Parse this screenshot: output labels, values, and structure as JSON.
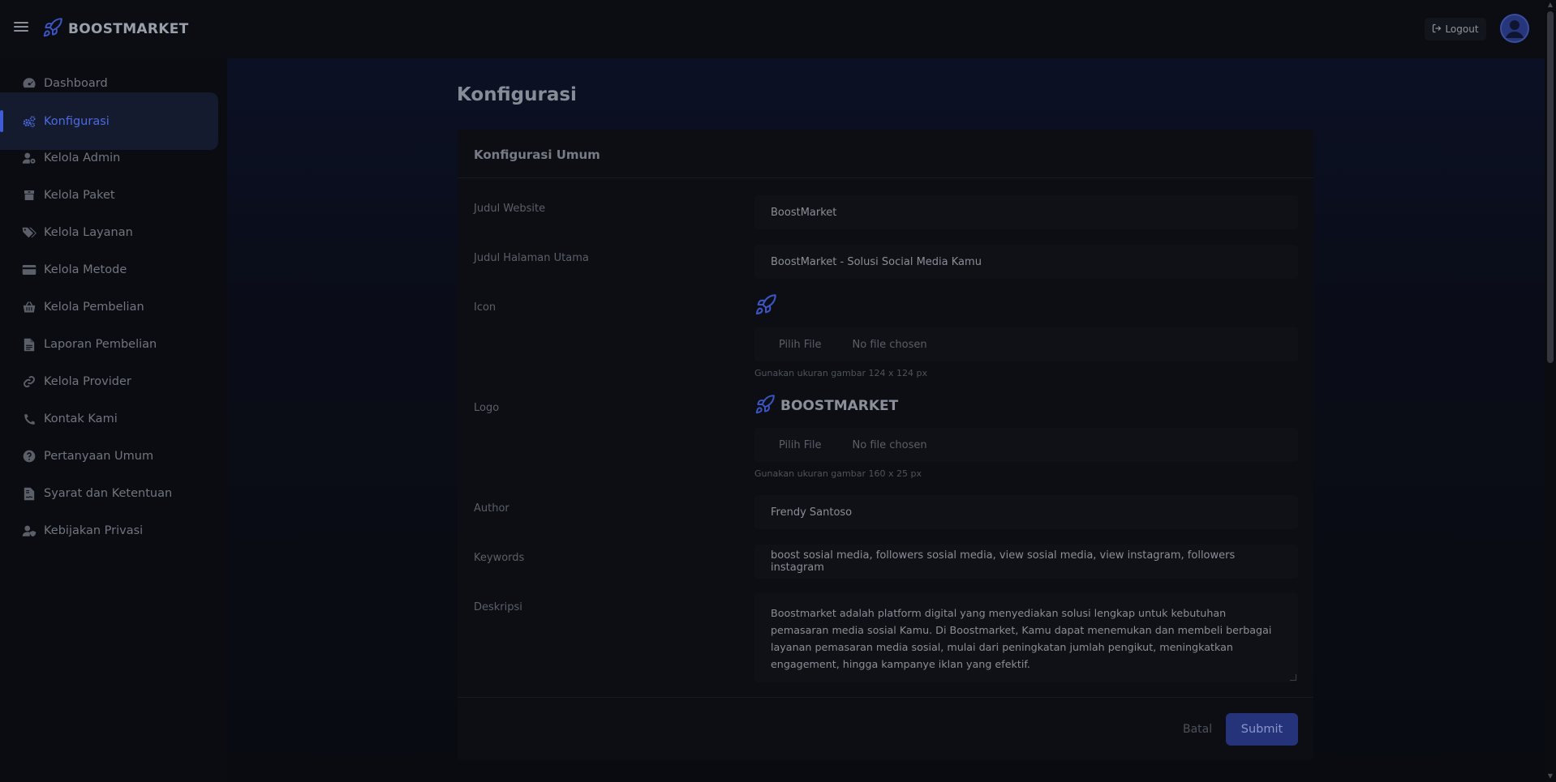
{
  "colors": {
    "accent": "#3f5bd6",
    "background": "#090b11",
    "submit": "#25347a"
  },
  "header": {
    "brand": "BOOSTMARKET",
    "logout_label": "Logout"
  },
  "sidebar": {
    "items": [
      {
        "label": "Dashboard",
        "icon": "gauge-icon"
      },
      {
        "label": "Konfigurasi",
        "icon": "gears-icon",
        "active": true
      },
      {
        "label": "Kelola Admin",
        "icon": "user-gear-icon"
      },
      {
        "label": "Kelola Paket",
        "icon": "box-icon"
      },
      {
        "label": "Kelola Layanan",
        "icon": "tags-icon"
      },
      {
        "label": "Kelola Metode",
        "icon": "credit-card-icon"
      },
      {
        "label": "Kelola Pembelian",
        "icon": "basket-icon"
      },
      {
        "label": "Laporan Pembelian",
        "icon": "file-icon"
      },
      {
        "label": "Kelola Provider",
        "icon": "link-icon"
      },
      {
        "label": "Kontak Kami",
        "icon": "phone-icon"
      },
      {
        "label": "Pertanyaan Umum",
        "icon": "question-circle-icon"
      },
      {
        "label": "Syarat dan Ketentuan",
        "icon": "file-contract-icon"
      },
      {
        "label": "Kebijakan Privasi",
        "icon": "user-shield-icon"
      }
    ]
  },
  "main": {
    "page_title": "Konfigurasi",
    "card_title": "Konfigurasi Umum",
    "fields": {
      "judul_website": {
        "label": "Judul Website",
        "value": "BoostMarket"
      },
      "judul_halaman": {
        "label": "Judul Halaman Utama",
        "value": "BoostMarket - Solusi Social Media Kamu"
      },
      "icon": {
        "label": "Icon",
        "file_button": "Pilih File",
        "file_status": "No file chosen",
        "hint": "Gunakan ukuran gambar 124 x 124 px"
      },
      "logo": {
        "label": "Logo",
        "logo_text": "BOOSTMARKET",
        "file_button": "Pilih File",
        "file_status": "No file chosen",
        "hint": "Gunakan ukuran gambar 160 x 25 px"
      },
      "author": {
        "label": "Author",
        "value": "Frendy Santoso"
      },
      "keywords": {
        "label": "Keywords",
        "value": "boost sosial media, followers sosial media, view sosial media, view instagram, followers instagram"
      },
      "deskripsi": {
        "label": "Deskripsi",
        "value": "Boostmarket adalah platform digital yang menyediakan solusi lengkap untuk kebutuhan pemasaran media sosial Kamu. Di Boostmarket, Kamu dapat menemukan dan membeli berbagai layanan pemasaran media sosial, mulai dari peningkatan jumlah pengikut, meningkatkan engagement, hingga kampanye iklan yang efektif."
      }
    },
    "actions": {
      "cancel_label": "Batal",
      "submit_label": "Submit"
    }
  }
}
